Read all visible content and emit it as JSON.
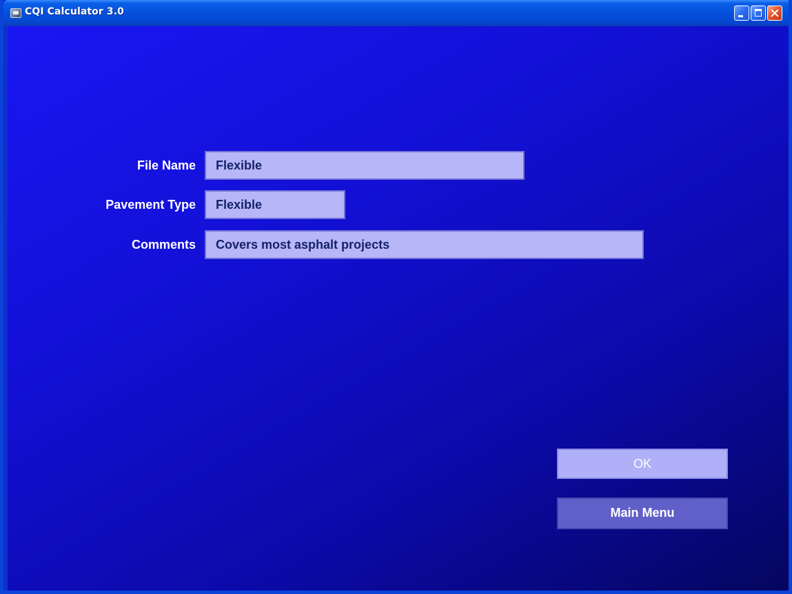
{
  "window": {
    "title": "CQI Calculator 3.0",
    "icons": {
      "app": "app-icon",
      "minimize": "minimize-icon",
      "maximize": "maximize-icon",
      "close": "close-icon"
    }
  },
  "form": {
    "file_name": {
      "label": "File Name",
      "value": "Flexible"
    },
    "pavement_type": {
      "label": "Pavement Type",
      "value": "Flexible"
    },
    "comments": {
      "label": "Comments",
      "value": "Covers most asphalt projects"
    }
  },
  "buttons": {
    "ok": "OK",
    "main_menu": "Main Menu"
  },
  "colors": {
    "background": "#1310d6",
    "field_background": "#b6b6f8",
    "field_text": "#16226a",
    "ok_button": "#b0b0f8",
    "main_menu_button": "#6060c8"
  }
}
